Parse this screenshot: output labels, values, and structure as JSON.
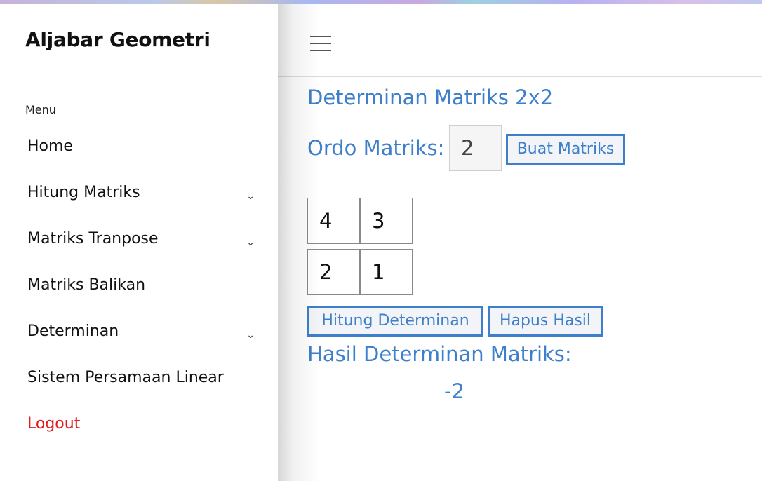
{
  "sidebar": {
    "brand": "Aljabar Geometri",
    "menu_heading": "Menu",
    "items": [
      {
        "label": "Home"
      },
      {
        "label": "Hitung Matriks",
        "chevron": "⌄"
      },
      {
        "label": "Matriks Tranpose",
        "chevron": "⌄"
      },
      {
        "label": "Matriks Balikan"
      },
      {
        "label": "Determinan",
        "chevron": "⌄"
      },
      {
        "label": "Sistem Persamaan Linear"
      },
      {
        "label": "Logout"
      }
    ]
  },
  "topbar": {
    "menu_icon": "hamburger-icon"
  },
  "main": {
    "title": "Determinan Matriks 2x2",
    "ordo_label": "Ordo Matriks:",
    "ordo_value": "2",
    "buat_button": "Buat Matriks",
    "matrix": [
      [
        "4",
        "3"
      ],
      [
        "2",
        "1"
      ]
    ],
    "hitung_button": "Hitung Determinan",
    "hapus_button": "Hapus Hasil",
    "result_label": "Hasil Determinan Matriks:",
    "result_value": "-2"
  },
  "colors": {
    "accent": "#3d7fcb",
    "logout": "#e01b1b"
  }
}
